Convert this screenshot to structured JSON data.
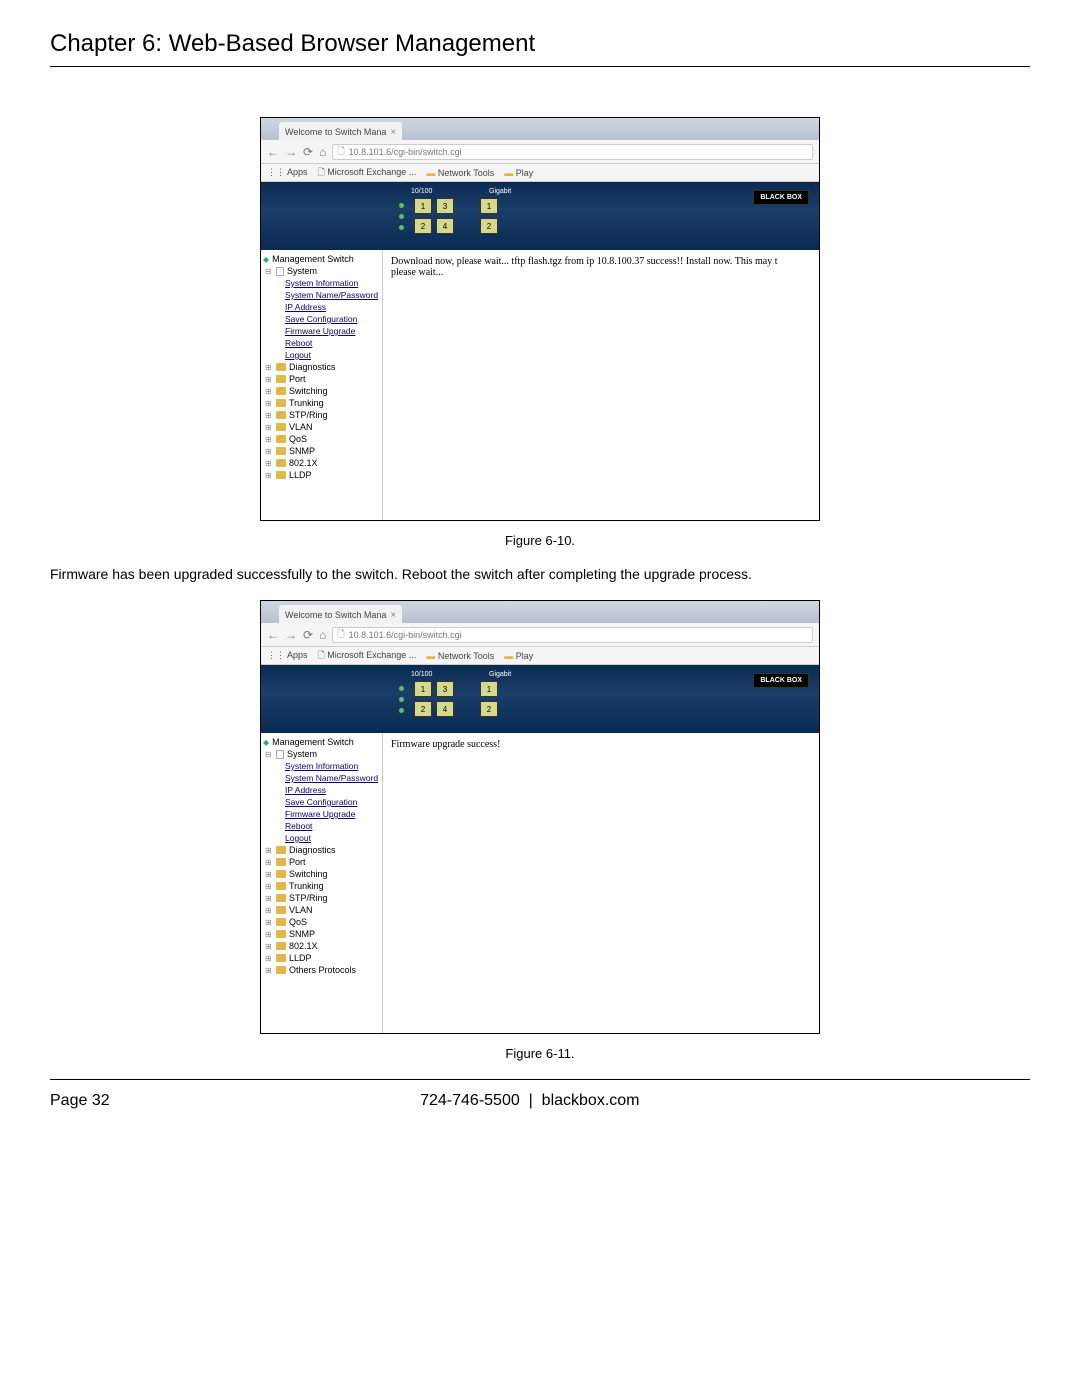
{
  "chapter_title": "Chapter 6: Web-Based Browser Management",
  "browser": {
    "tab_title": "Welcome to Switch Mana",
    "url": "10.8.101.6/cgi-bin/switch.cgi",
    "bookmarks": {
      "apps": "Apps",
      "exchange": "Microsoft Exchange ...",
      "nettools": "Network Tools",
      "play": "Play"
    }
  },
  "banner": {
    "rate_label": "10/100",
    "gigabit_label": "Gigabit",
    "logo_top": "BLACK BOX"
  },
  "tree": {
    "root": "Management Switch",
    "system": "System",
    "system_items": [
      "System Information",
      "System Name/Password",
      "IP Address",
      "Save Configuration",
      "Firmware Upgrade",
      "Reboot",
      "Logout"
    ],
    "folders1": [
      "Diagnostics",
      "Port",
      "Switching",
      "Trunking",
      "STP/Ring",
      "VLAN",
      "QoS",
      "SNMP",
      "802.1X",
      "LLDP"
    ],
    "folders2": [
      "Diagnostics",
      "Port",
      "Switching",
      "Trunking",
      "STP/Ring",
      "VLAN",
      "QoS",
      "SNMP",
      "802.1X",
      "LLDP",
      "Others Protocols"
    ]
  },
  "content1": "Download now, please wait... tftp flash.tgz from ip 10.8.100.37 success!! Install now. This may t",
  "content1b": "please wait...",
  "content2": "Firmware upgrade success!",
  "fig1": "Figure 6-10.",
  "body1": "Firmware has been upgraded successfully to the switch. Reboot the switch after completing the upgrade process.",
  "fig2": "Figure 6-11.",
  "footer": {
    "page": "Page 32",
    "phone": "724-746-5500",
    "site": "blackbox.com"
  }
}
